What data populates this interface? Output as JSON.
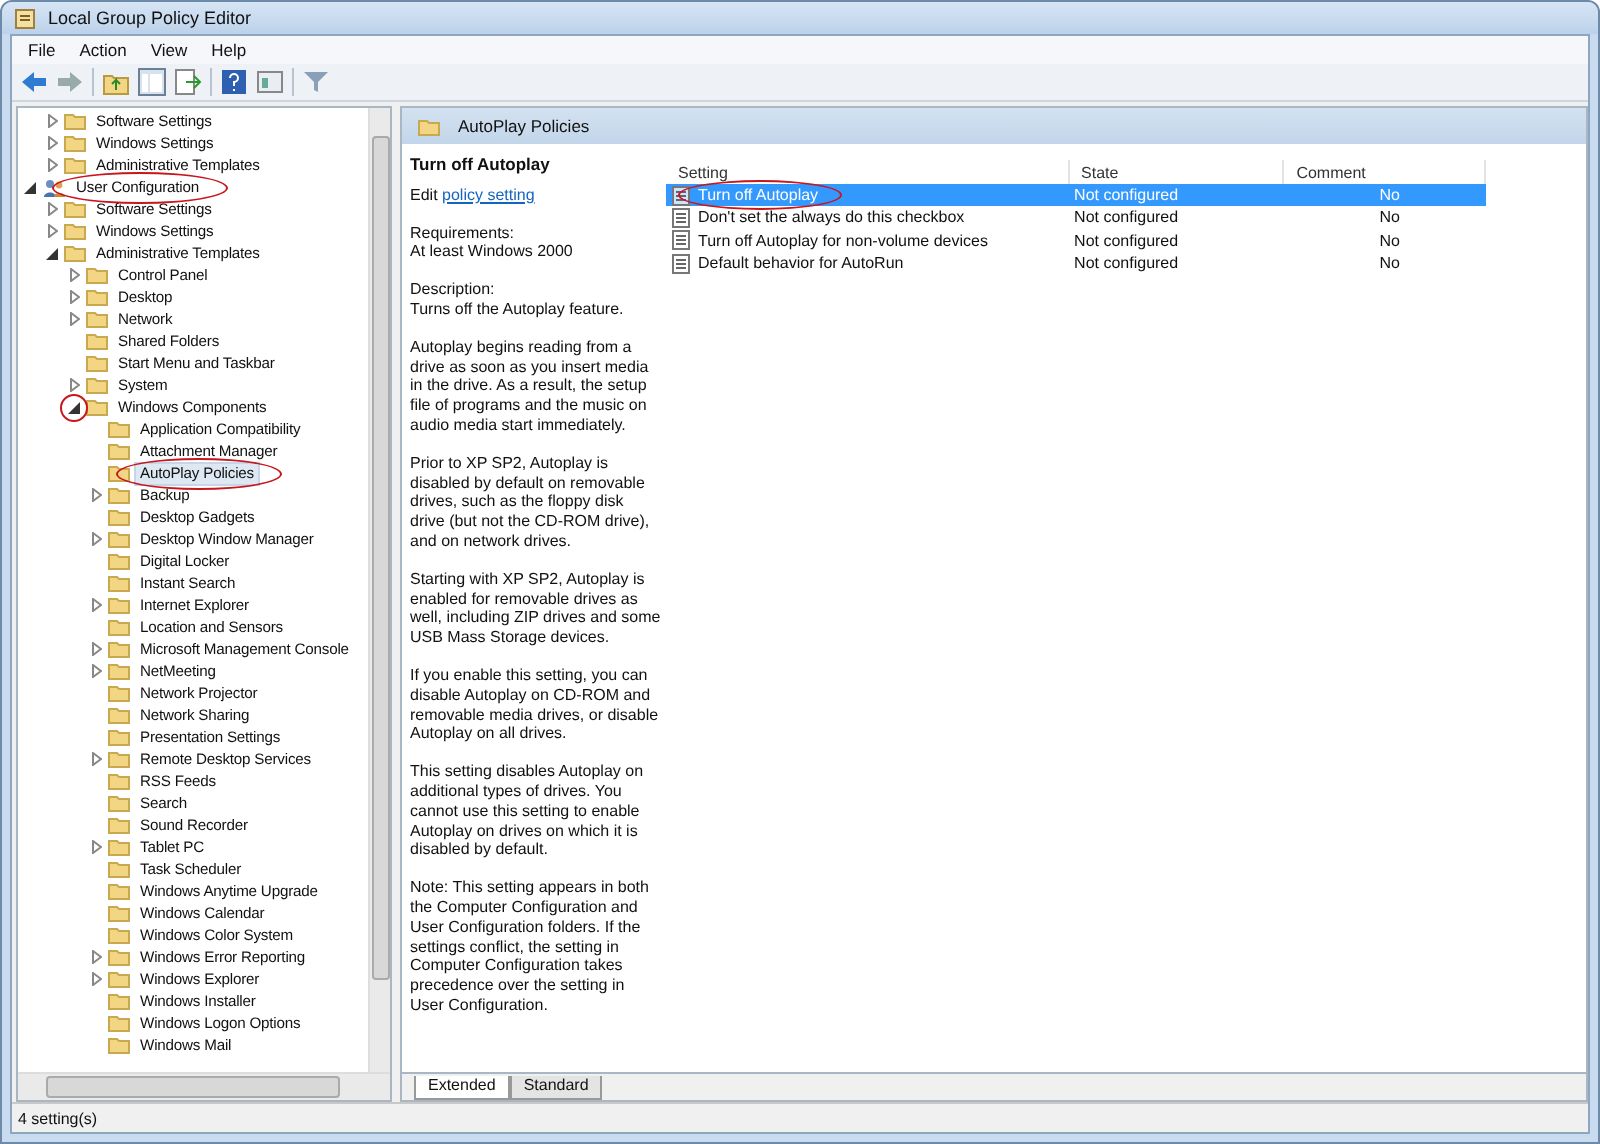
{
  "window": {
    "title": "Local Group Policy Editor"
  },
  "menu": [
    "File",
    "Action",
    "View",
    "Help"
  ],
  "tree": [
    {
      "label": "Software Settings",
      "kind": "folder",
      "expandable": true,
      "expanded": false,
      "selected": false
    },
    {
      "label": "Windows Settings",
      "kind": "folder",
      "expandable": true,
      "expanded": false,
      "selected": false
    },
    {
      "label": "Administrative Templates",
      "kind": "folder",
      "expandable": true,
      "expanded": false,
      "selected": false
    },
    {
      "label": "User Configuration",
      "kind": "root",
      "expandable": true,
      "expanded": true,
      "selected": false,
      "circled": true,
      "children": [
        {
          "label": "Software Settings",
          "kind": "folder",
          "expandable": true,
          "expanded": false,
          "selected": false
        },
        {
          "label": "Windows Settings",
          "kind": "folder",
          "expandable": true,
          "expanded": false,
          "selected": false
        },
        {
          "label": "Administrative Templates",
          "kind": "folder",
          "expandable": true,
          "expanded": true,
          "selected": false,
          "children": [
            {
              "label": "Control Panel",
              "kind": "folder",
              "expandable": true,
              "expanded": false,
              "selected": false
            },
            {
              "label": "Desktop",
              "kind": "folder",
              "expandable": true,
              "expanded": false,
              "selected": false
            },
            {
              "label": "Network",
              "kind": "folder",
              "expandable": true,
              "expanded": false,
              "selected": false
            },
            {
              "label": "Shared Folders",
              "kind": "folder",
              "expandable": false,
              "selected": false
            },
            {
              "label": "Start Menu and Taskbar",
              "kind": "folder",
              "expandable": false,
              "selected": false
            },
            {
              "label": "System",
              "kind": "folder",
              "expandable": true,
              "expanded": false,
              "selected": false
            },
            {
              "label": "Windows Components",
              "kind": "folder",
              "expandable": true,
              "expanded": true,
              "selected": false,
              "expander_circled": true,
              "children": [
                {
                  "label": "Application Compatibility",
                  "kind": "folder",
                  "expandable": false,
                  "selected": false
                },
                {
                  "label": "Attachment Manager",
                  "kind": "folder",
                  "expandable": false,
                  "selected": false
                },
                {
                  "label": "AutoPlay Policies",
                  "kind": "folder",
                  "expandable": false,
                  "selected": true,
                  "circled": true
                },
                {
                  "label": "Backup",
                  "kind": "folder",
                  "expandable": true,
                  "expanded": false,
                  "selected": false
                },
                {
                  "label": "Desktop Gadgets",
                  "kind": "folder",
                  "expandable": false,
                  "selected": false
                },
                {
                  "label": "Desktop Window Manager",
                  "kind": "folder",
                  "expandable": true,
                  "expanded": false,
                  "selected": false
                },
                {
                  "label": "Digital Locker",
                  "kind": "folder",
                  "expandable": false,
                  "selected": false
                },
                {
                  "label": "Instant Search",
                  "kind": "folder",
                  "expandable": false,
                  "selected": false
                },
                {
                  "label": "Internet Explorer",
                  "kind": "folder",
                  "expandable": true,
                  "expanded": false,
                  "selected": false
                },
                {
                  "label": "Location and Sensors",
                  "kind": "folder",
                  "expandable": false,
                  "selected": false
                },
                {
                  "label": "Microsoft Management Console",
                  "kind": "folder",
                  "expandable": true,
                  "expanded": false,
                  "selected": false
                },
                {
                  "label": "NetMeeting",
                  "kind": "folder",
                  "expandable": true,
                  "expanded": false,
                  "selected": false
                },
                {
                  "label": "Network Projector",
                  "kind": "folder",
                  "expandable": false,
                  "selected": false
                },
                {
                  "label": "Network Sharing",
                  "kind": "folder",
                  "expandable": false,
                  "selected": false
                },
                {
                  "label": "Presentation Settings",
                  "kind": "folder",
                  "expandable": false,
                  "selected": false
                },
                {
                  "label": "Remote Desktop Services",
                  "kind": "folder",
                  "expandable": true,
                  "expanded": false,
                  "selected": false
                },
                {
                  "label": "RSS Feeds",
                  "kind": "folder",
                  "expandable": false,
                  "selected": false
                },
                {
                  "label": "Search",
                  "kind": "folder",
                  "expandable": false,
                  "selected": false
                },
                {
                  "label": "Sound Recorder",
                  "kind": "folder",
                  "expandable": false,
                  "selected": false
                },
                {
                  "label": "Tablet PC",
                  "kind": "folder",
                  "expandable": true,
                  "expanded": false,
                  "selected": false
                },
                {
                  "label": "Task Scheduler",
                  "kind": "folder",
                  "expandable": false,
                  "selected": false
                },
                {
                  "label": "Windows Anytime Upgrade",
                  "kind": "folder",
                  "expandable": false,
                  "selected": false
                },
                {
                  "label": "Windows Calendar",
                  "kind": "folder",
                  "expandable": false,
                  "selected": false
                },
                {
                  "label": "Windows Color System",
                  "kind": "folder",
                  "expandable": false,
                  "selected": false
                },
                {
                  "label": "Windows Error Reporting",
                  "kind": "folder",
                  "expandable": true,
                  "expanded": false,
                  "selected": false
                },
                {
                  "label": "Windows Explorer",
                  "kind": "folder",
                  "expandable": true,
                  "expanded": false,
                  "selected": false
                },
                {
                  "label": "Windows Installer",
                  "kind": "folder",
                  "expandable": false,
                  "selected": false
                },
                {
                  "label": "Windows Logon Options",
                  "kind": "folder",
                  "expandable": false,
                  "selected": false
                },
                {
                  "label": "Windows Mail",
                  "kind": "folder",
                  "expandable": false,
                  "selected": false
                }
              ]
            }
          ]
        }
      ]
    }
  ],
  "panel": {
    "title": "AutoPlay Policies",
    "details": {
      "heading": "Turn off Autoplay",
      "edit_prefix": "Edit",
      "edit_link": "policy setting",
      "paragraphs": [
        "Requirements:\nAt least Windows 2000",
        "Description:\nTurns off the Autoplay feature.",
        "Autoplay begins reading from a drive as soon as you insert media in the drive. As a result, the setup file of programs and the music on audio media start immediately.",
        "Prior to XP SP2, Autoplay is disabled by default on removable drives, such as the floppy disk drive (but not the CD-ROM drive), and on network drives.",
        "Starting with XP SP2, Autoplay is enabled for removable drives as well, including ZIP drives and some USB Mass Storage devices.",
        "If you enable this setting, you can disable Autoplay on CD-ROM and removable media drives, or disable Autoplay on all drives.",
        "This setting disables Autoplay on additional types of drives. You cannot use this setting to enable Autoplay on drives on which it is disabled by default.",
        "Note: This setting appears in both the Computer Configuration and User Configuration folders. If the settings conflict, the setting in Computer Configuration takes precedence over the setting in User Configuration."
      ]
    },
    "table": {
      "columns": [
        "Setting",
        "State",
        "Comment"
      ],
      "rows": [
        {
          "setting": "Turn off Autoplay",
          "state": "Not configured",
          "comment": "No",
          "selected": true,
          "circled": true
        },
        {
          "setting": "Don't set the always do this checkbox",
          "state": "Not configured",
          "comment": "No",
          "selected": false
        },
        {
          "setting": "Turn off Autoplay for non-volume devices",
          "state": "Not configured",
          "comment": "No",
          "selected": false
        },
        {
          "setting": "Default behavior for AutoRun",
          "state": "Not configured",
          "comment": "No",
          "selected": false
        }
      ]
    },
    "tabs": [
      {
        "label": "Extended",
        "selected": true
      },
      {
        "label": "Standard",
        "selected": false
      }
    ]
  },
  "status_bar": {
    "text": "4 setting(s)"
  }
}
